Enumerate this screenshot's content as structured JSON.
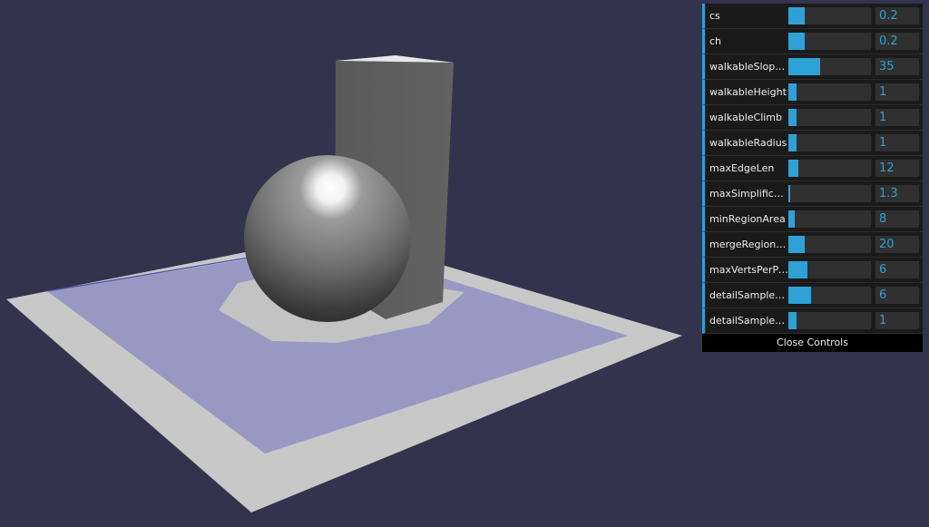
{
  "scene": {
    "background_color": "#33334d",
    "objects": [
      "ground-plane",
      "navmesh-overlay",
      "box",
      "sphere"
    ]
  },
  "gui": {
    "accent_color": "#2fa1d6",
    "controls": [
      {
        "label": "cs",
        "value": "0.2",
        "fill": 0.2
      },
      {
        "label": "ch",
        "value": "0.2",
        "fill": 0.2
      },
      {
        "label": "walkableSlopeAngle",
        "value": "35",
        "fill": 0.39
      },
      {
        "label": "walkableHeight",
        "value": "1",
        "fill": 0.1
      },
      {
        "label": "walkableClimb",
        "value": "1",
        "fill": 0.1
      },
      {
        "label": "walkableRadius",
        "value": "1",
        "fill": 0.1
      },
      {
        "label": "maxEdgeLen",
        "value": "12",
        "fill": 0.12
      },
      {
        "label": "maxSimplificationError",
        "value": "1.3",
        "fill": 0.02
      },
      {
        "label": "minRegionArea",
        "value": "8",
        "fill": 0.08
      },
      {
        "label": "mergeRegionArea",
        "value": "20",
        "fill": 0.2
      },
      {
        "label": "maxVertsPerPoly",
        "value": "6",
        "fill": 0.23
      },
      {
        "label": "detailSampleDist",
        "value": "6",
        "fill": 0.27
      },
      {
        "label": "detailSampleMaxError",
        "value": "1",
        "fill": 0.1
      }
    ],
    "close_label": "Close Controls"
  }
}
